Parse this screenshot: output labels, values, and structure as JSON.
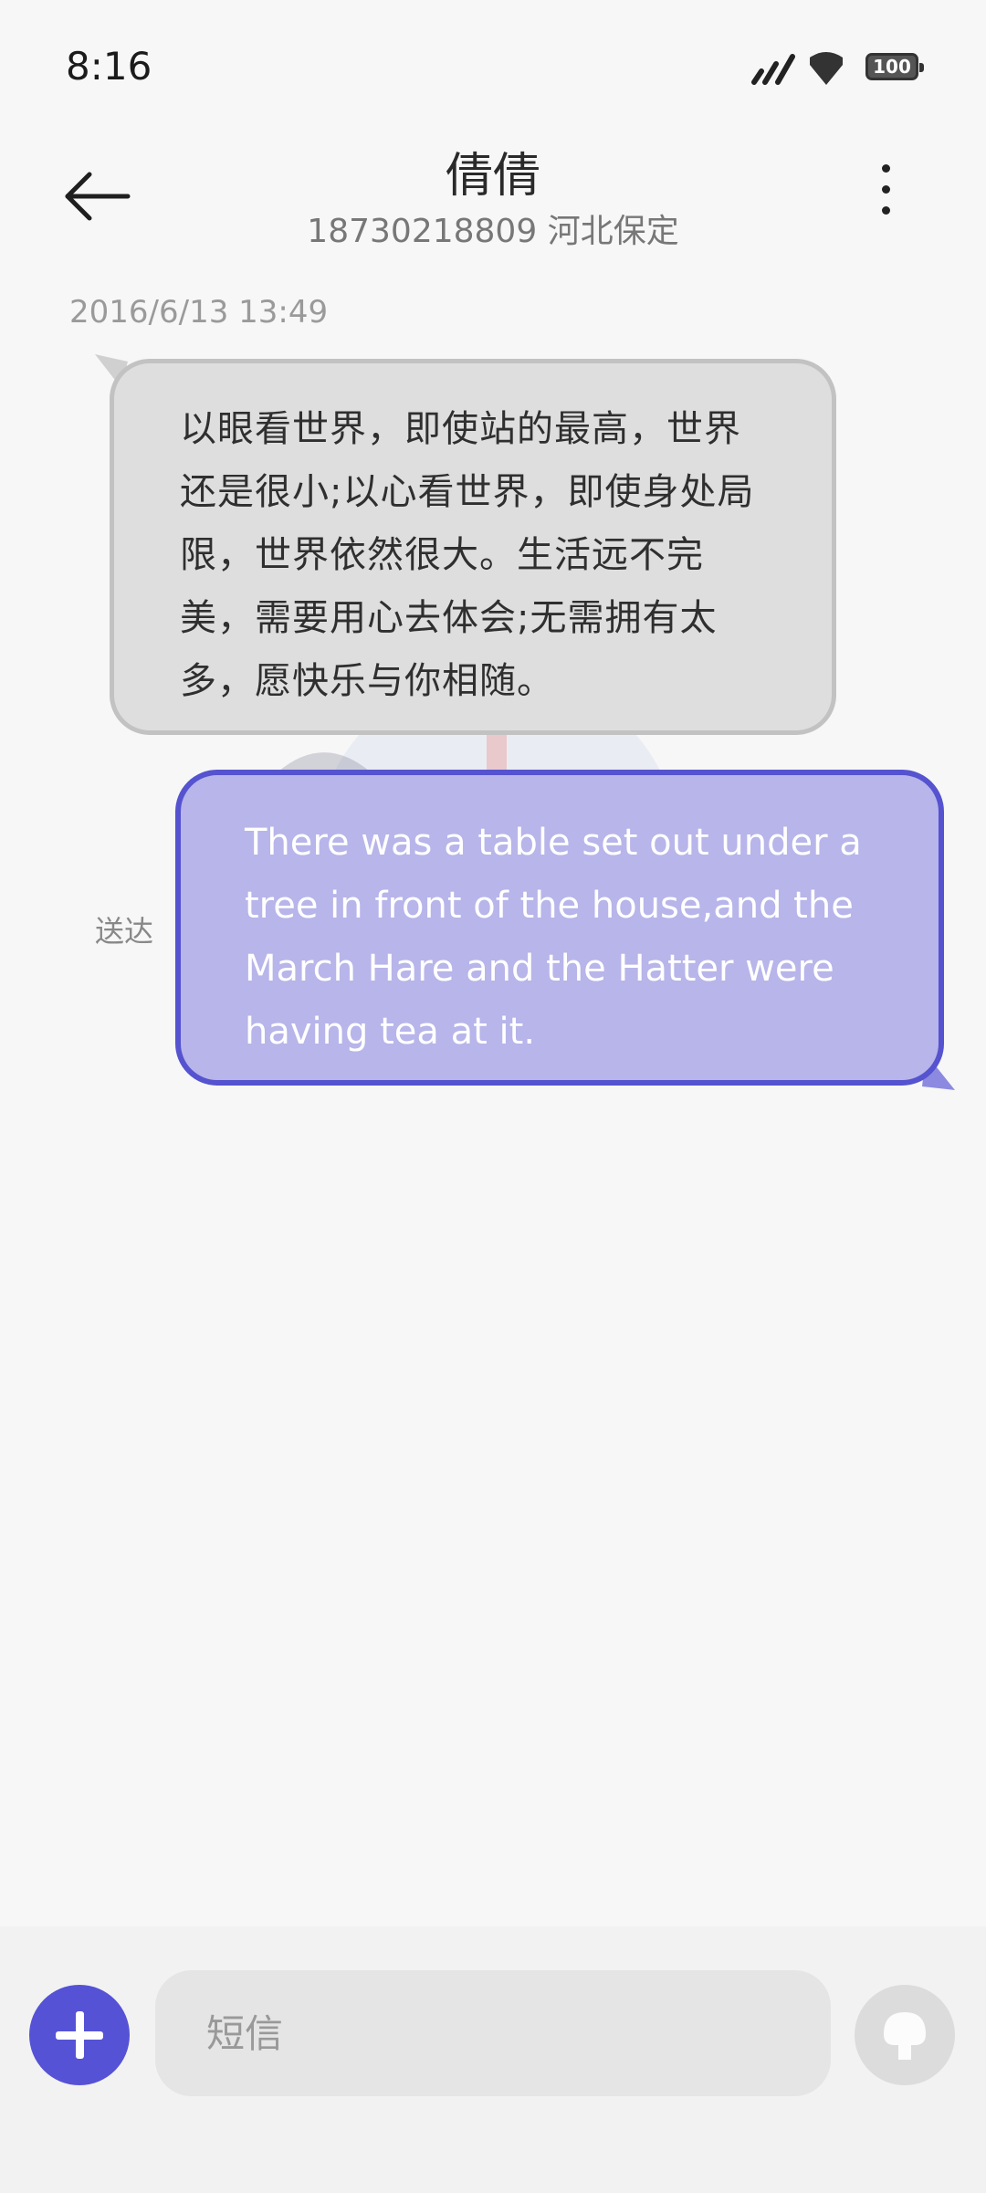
{
  "status_bar": {
    "time": "8:16",
    "battery": "100"
  },
  "header": {
    "contact_name": "倩倩",
    "contact_subtitle": "18730218809 河北保定",
    "back_icon": "arrow-left-icon",
    "more_icon": "more-vertical-icon"
  },
  "conversation": {
    "timestamp": "2016/6/13 13:49",
    "messages": [
      {
        "direction": "incoming",
        "text": "以眼看世界，即使站的最高，世界还是很小;以心看世界，即使身处局限，世界依然很大。生活远不完美，需要用心去体会;无需拥有太多，愿快乐与你相随。"
      },
      {
        "direction": "outgoing",
        "text": "There was a table set out under a tree in front of the house,and the March Hare and the Hatter were having tea at it.",
        "status": "送达"
      }
    ]
  },
  "composer": {
    "placeholder": "短信",
    "value": "",
    "add_icon": "plus-icon",
    "send_icon": "send-icon"
  },
  "colors": {
    "accent": "#5552d5",
    "outgoing_bubble": "#b7b5e9",
    "incoming_bubble": "#dedede"
  }
}
